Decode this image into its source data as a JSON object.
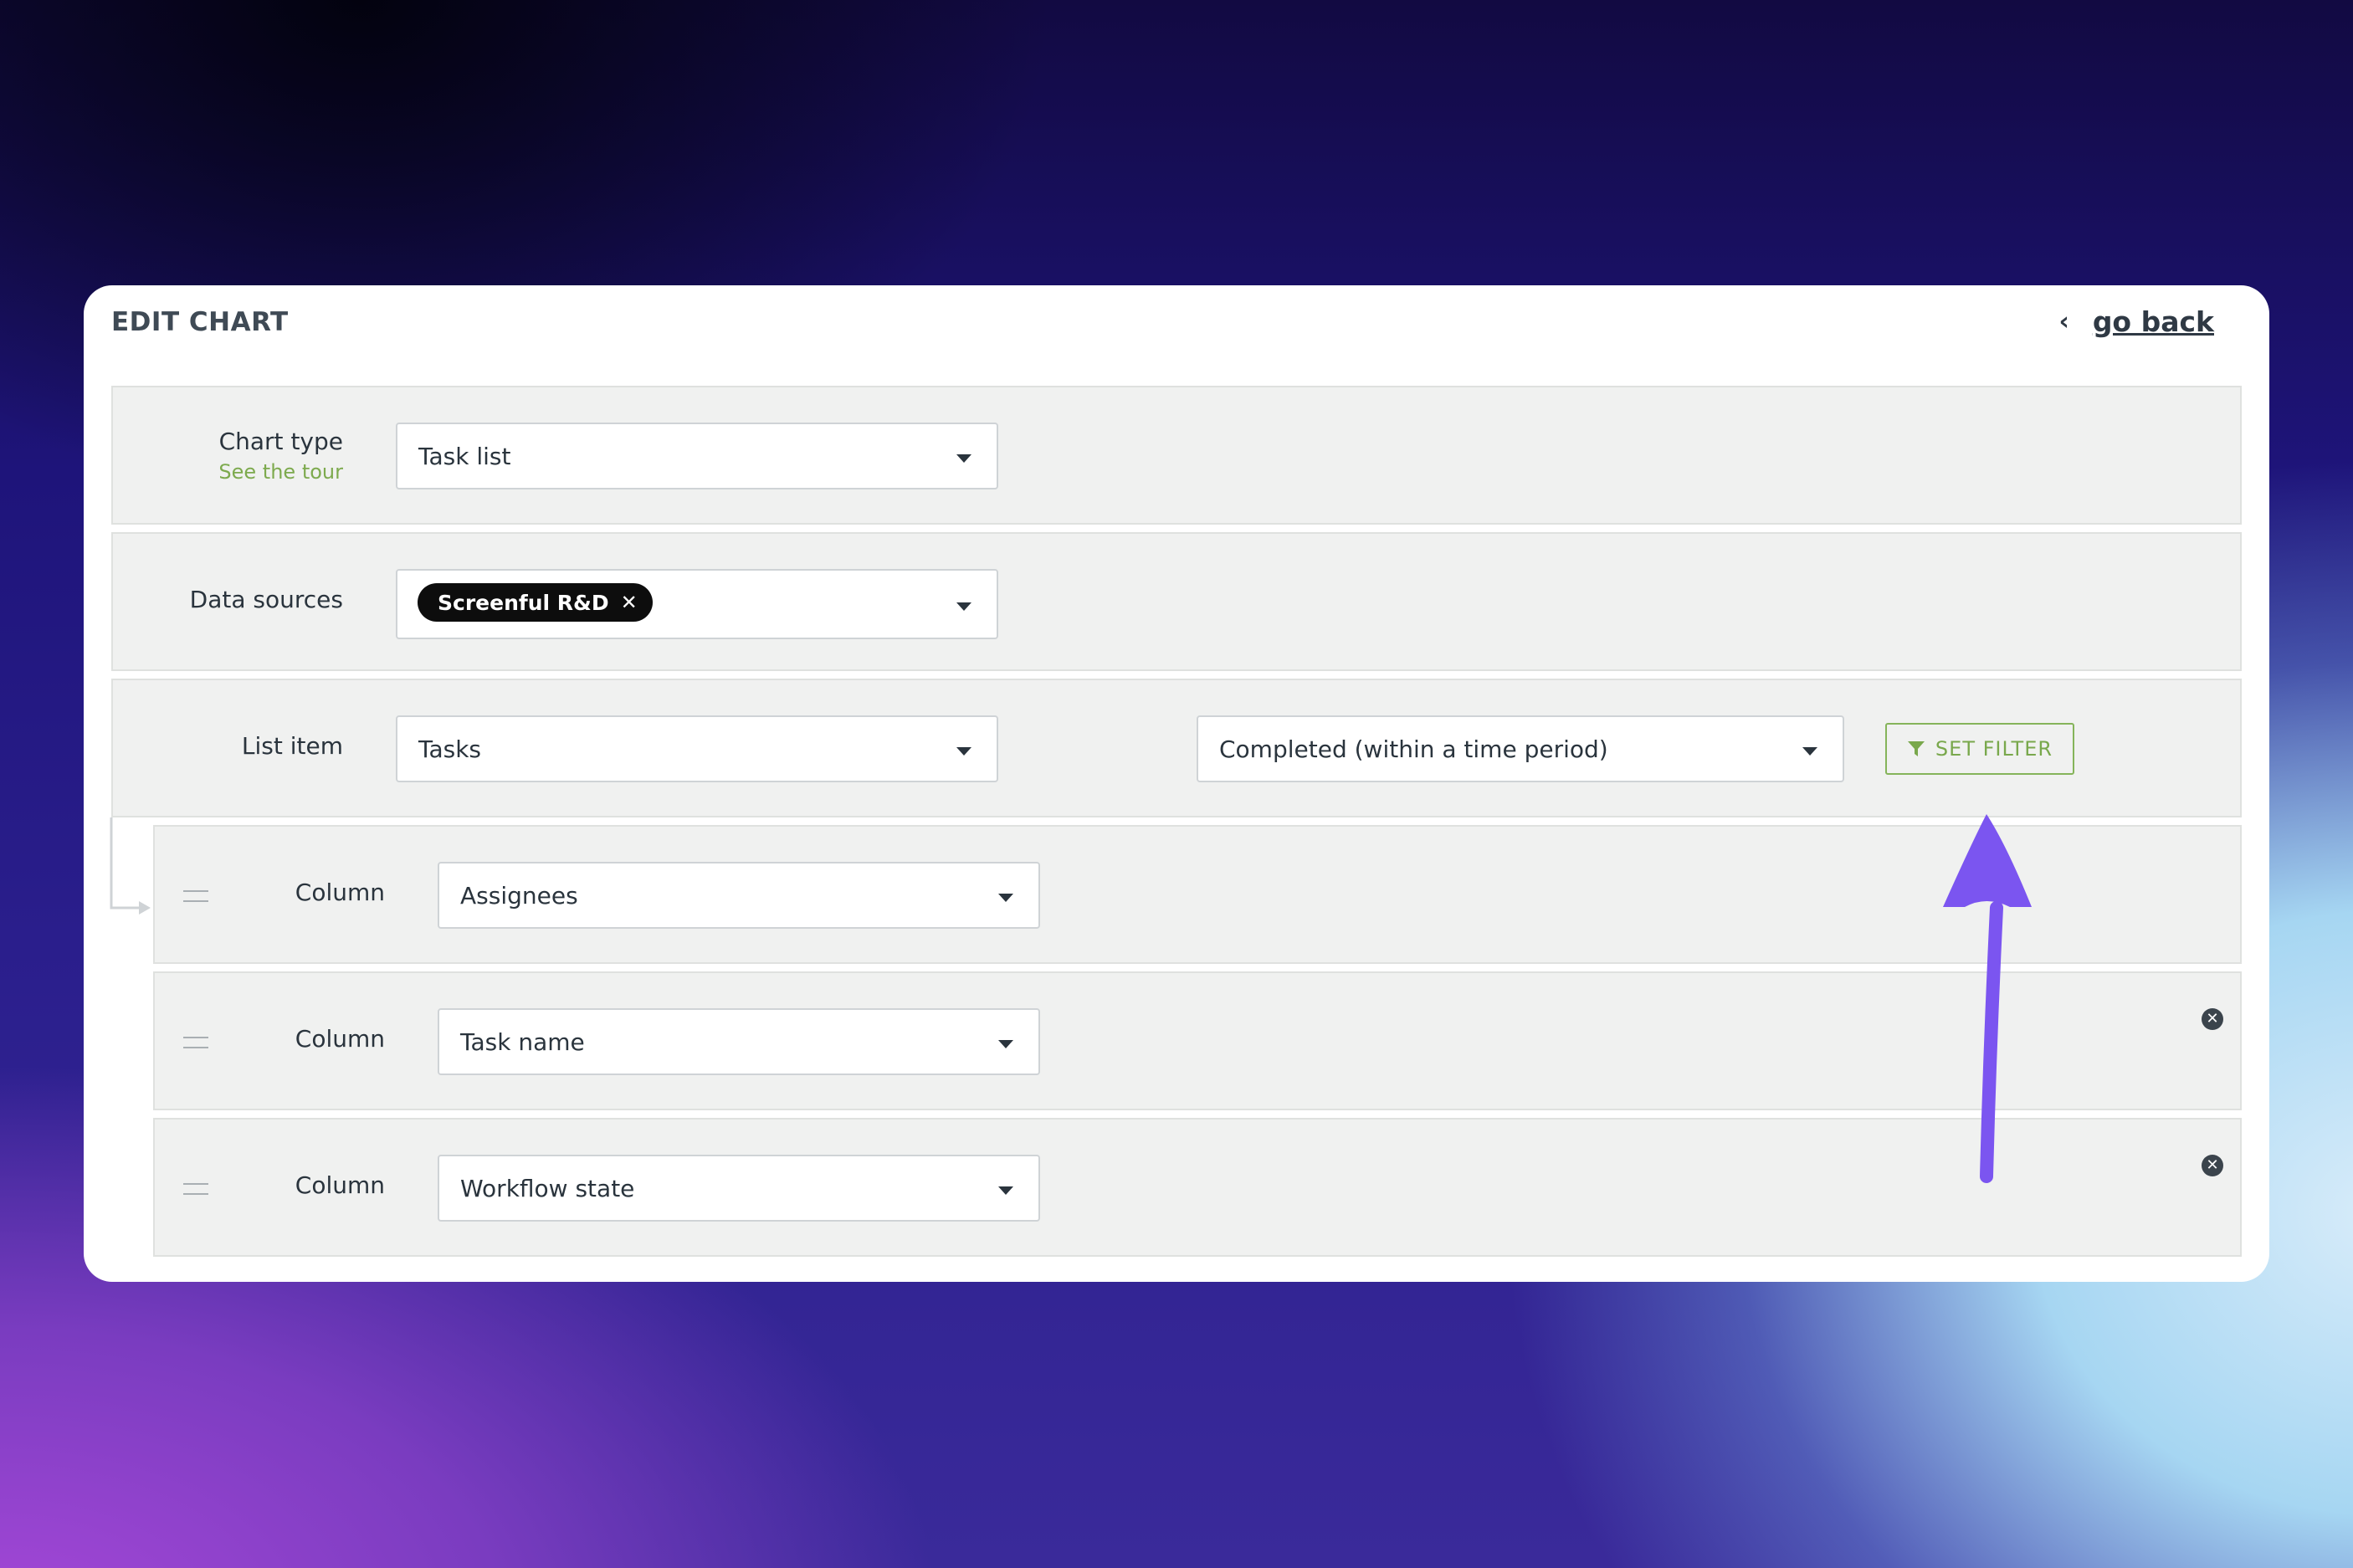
{
  "header": {
    "title": "EDIT CHART",
    "go_back_label": "go back"
  },
  "chart_type": {
    "label": "Chart type",
    "sublabel": "See the tour",
    "value": "Task list"
  },
  "data_sources": {
    "label": "Data sources",
    "chips": [
      "Screenful R&D"
    ]
  },
  "list_item": {
    "label": "List item",
    "value": "Tasks",
    "condition_value": "Completed (within a time period)",
    "filter_button_label": "SET FILTER"
  },
  "columns": [
    {
      "label": "Column",
      "value": "Assignees",
      "removable": false
    },
    {
      "label": "Column",
      "value": "Task name",
      "removable": true
    },
    {
      "label": "Column",
      "value": "Workflow state",
      "removable": true
    }
  ],
  "colors": {
    "accent_green": "#79a84c",
    "annotation_arrow": "#7b55f0",
    "chip_bg": "#0d0d0d"
  },
  "icons": [
    "chevron-left-icon",
    "caret-down-icon",
    "close-icon",
    "funnel-icon",
    "drag-handle-icon",
    "remove-circle-icon",
    "annotation-arrow"
  ]
}
